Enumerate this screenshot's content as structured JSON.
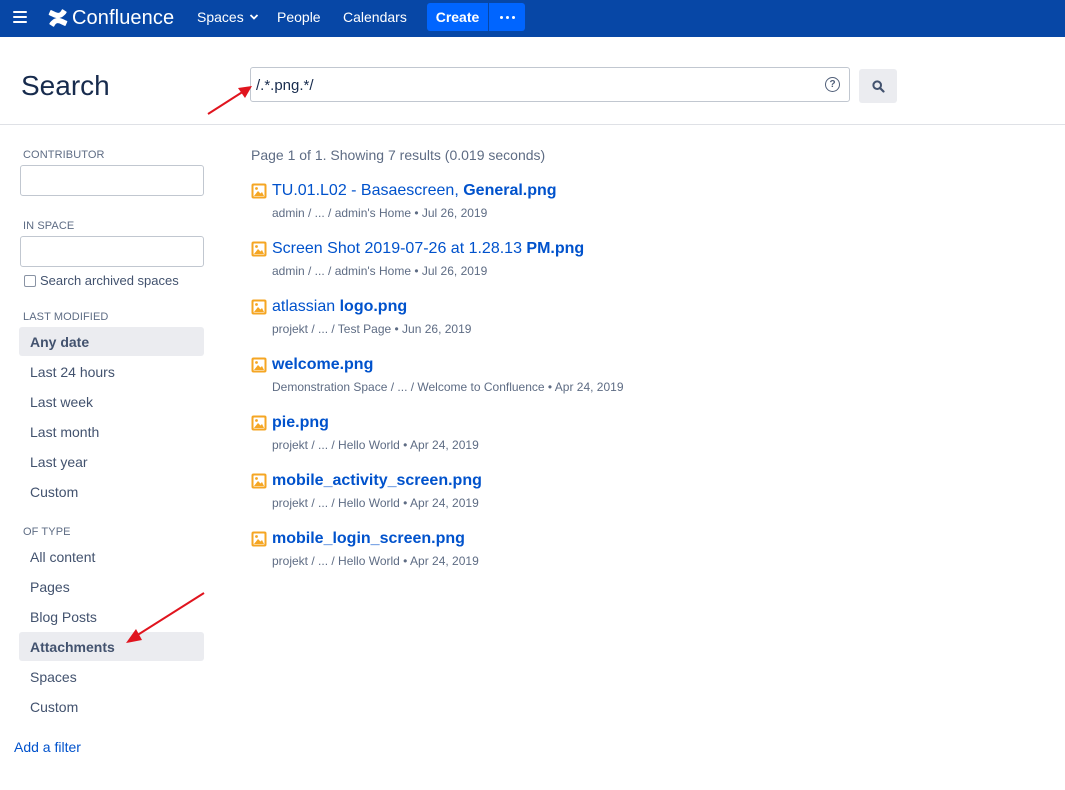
{
  "nav": {
    "logo_text": "Confluence",
    "spaces": "Spaces",
    "people": "People",
    "calendars": "Calendars",
    "create": "Create",
    "bar_color": "#0747a6"
  },
  "header": {
    "title": "Search",
    "query": "/.*.png.*/",
    "help_glyph": "?"
  },
  "sidebar": {
    "contributor_heading": "CONTRIBUTOR",
    "in_space_heading": "IN SPACE",
    "archived_label": "Search archived spaces",
    "last_modified_heading": "LAST MODIFIED",
    "last_modified_options": [
      "Any date",
      "Last 24 hours",
      "Last week",
      "Last month",
      "Last year",
      "Custom"
    ],
    "last_modified_selected": "Any date",
    "of_type_heading": "OF TYPE",
    "type_options": [
      "All content",
      "Pages",
      "Blog Posts",
      "Attachments",
      "Spaces",
      "Custom"
    ],
    "type_selected": "Attachments",
    "add_filter": "Add a filter"
  },
  "results": {
    "summary": "Page 1 of 1. Showing 7 results (0.019 seconds)",
    "items": [
      {
        "title_pre": "TU.01.L02 - Basaescreen, ",
        "title_bold": "General.png",
        "meta": "admin / ... / admin's Home • Jul 26, 2019"
      },
      {
        "title_pre": "Screen Shot 2019-07-26 at 1.28.13 ",
        "title_bold": "PM.png",
        "meta": "admin / ... / admin's Home • Jul 26, 2019"
      },
      {
        "title_pre": "atlassian ",
        "title_bold": "logo.png",
        "meta": "projekt / ... / Test Page • Jun 26, 2019"
      },
      {
        "title_pre": "",
        "title_bold": "welcome.png",
        "meta": "Demonstration Space / ... / Welcome to Confluence • Apr 24, 2019"
      },
      {
        "title_pre": "",
        "title_bold": "pie.png",
        "meta": "projekt / ... / Hello World • Apr 24, 2019"
      },
      {
        "title_pre": "",
        "title_bold": "mobile_activity_screen.png",
        "meta": "projekt / ... / Hello World • Apr 24, 2019"
      },
      {
        "title_pre": "",
        "title_bold": "mobile_login_screen.png",
        "meta": "projekt / ... / Hello World • Apr 24, 2019"
      }
    ]
  },
  "icons": {
    "menu": "hamburger-menu-icon",
    "logo": "confluence-logo-icon",
    "help": "help-icon",
    "search": "search-icon",
    "image": "image-file-icon",
    "annotation": "red-arrow-annotation"
  },
  "colors": {
    "link": "#0052cc",
    "attachment_icon": "#f5a623",
    "annotation": "#e0141e"
  }
}
